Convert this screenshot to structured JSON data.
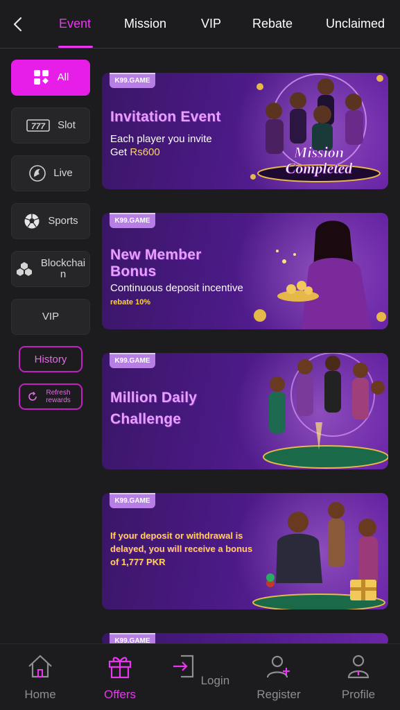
{
  "tabs": [
    {
      "label": "Event",
      "active": true
    },
    {
      "label": "Mission"
    },
    {
      "label": "VIP"
    },
    {
      "label": "Rebate"
    },
    {
      "label": "Unclaimed"
    }
  ],
  "sidebar": {
    "items": [
      {
        "label": "All",
        "icon": "grid-icon",
        "active": true
      },
      {
        "label": "Slot",
        "icon": "slot-777-icon"
      },
      {
        "label": "Live",
        "icon": "dealer-icon"
      },
      {
        "label": "Sports",
        "icon": "soccer-ball-icon"
      },
      {
        "label": "Blockchain",
        "icon": "blocks-icon"
      },
      {
        "label": "VIP"
      }
    ],
    "history_label": "History",
    "refresh_label": "Refresh rewards"
  },
  "banners": [
    {
      "brand": "K99.GAME",
      "title": "Invitation Event",
      "sub_prefix": "Each player you invite",
      "sub2_prefix": "Get ",
      "sub2_highlight": "Rs600",
      "badge_line1": "Mission",
      "badge_line2": "Completed"
    },
    {
      "brand": "K99.GAME",
      "title_line1": "New Member",
      "title_line2": "Bonus",
      "sub": "Continuous deposit incentive",
      "small": "rebate 10%"
    },
    {
      "brand": "K99.GAME",
      "title_line1": "Million Daily",
      "title_line2": "Challenge"
    },
    {
      "brand": "K99.GAME",
      "notice": "If your deposit or withdrawal is delayed, you will receive a bonus of 1,777 PKR"
    },
    {
      "brand": "K99.GAME"
    }
  ],
  "bottom_nav": [
    {
      "label": "Home",
      "icon": "home-icon"
    },
    {
      "label": "Offers",
      "icon": "gift-icon",
      "active": true
    },
    {
      "label": "Login",
      "icon": "login-icon"
    },
    {
      "label": "Register",
      "icon": "add-user-icon"
    },
    {
      "label": "Profile",
      "icon": "profile-icon"
    }
  ],
  "colors": {
    "accent": "#e936f0",
    "background": "#1c1c1e",
    "banner": "#4b1a86",
    "gold": "#ffd45a"
  }
}
